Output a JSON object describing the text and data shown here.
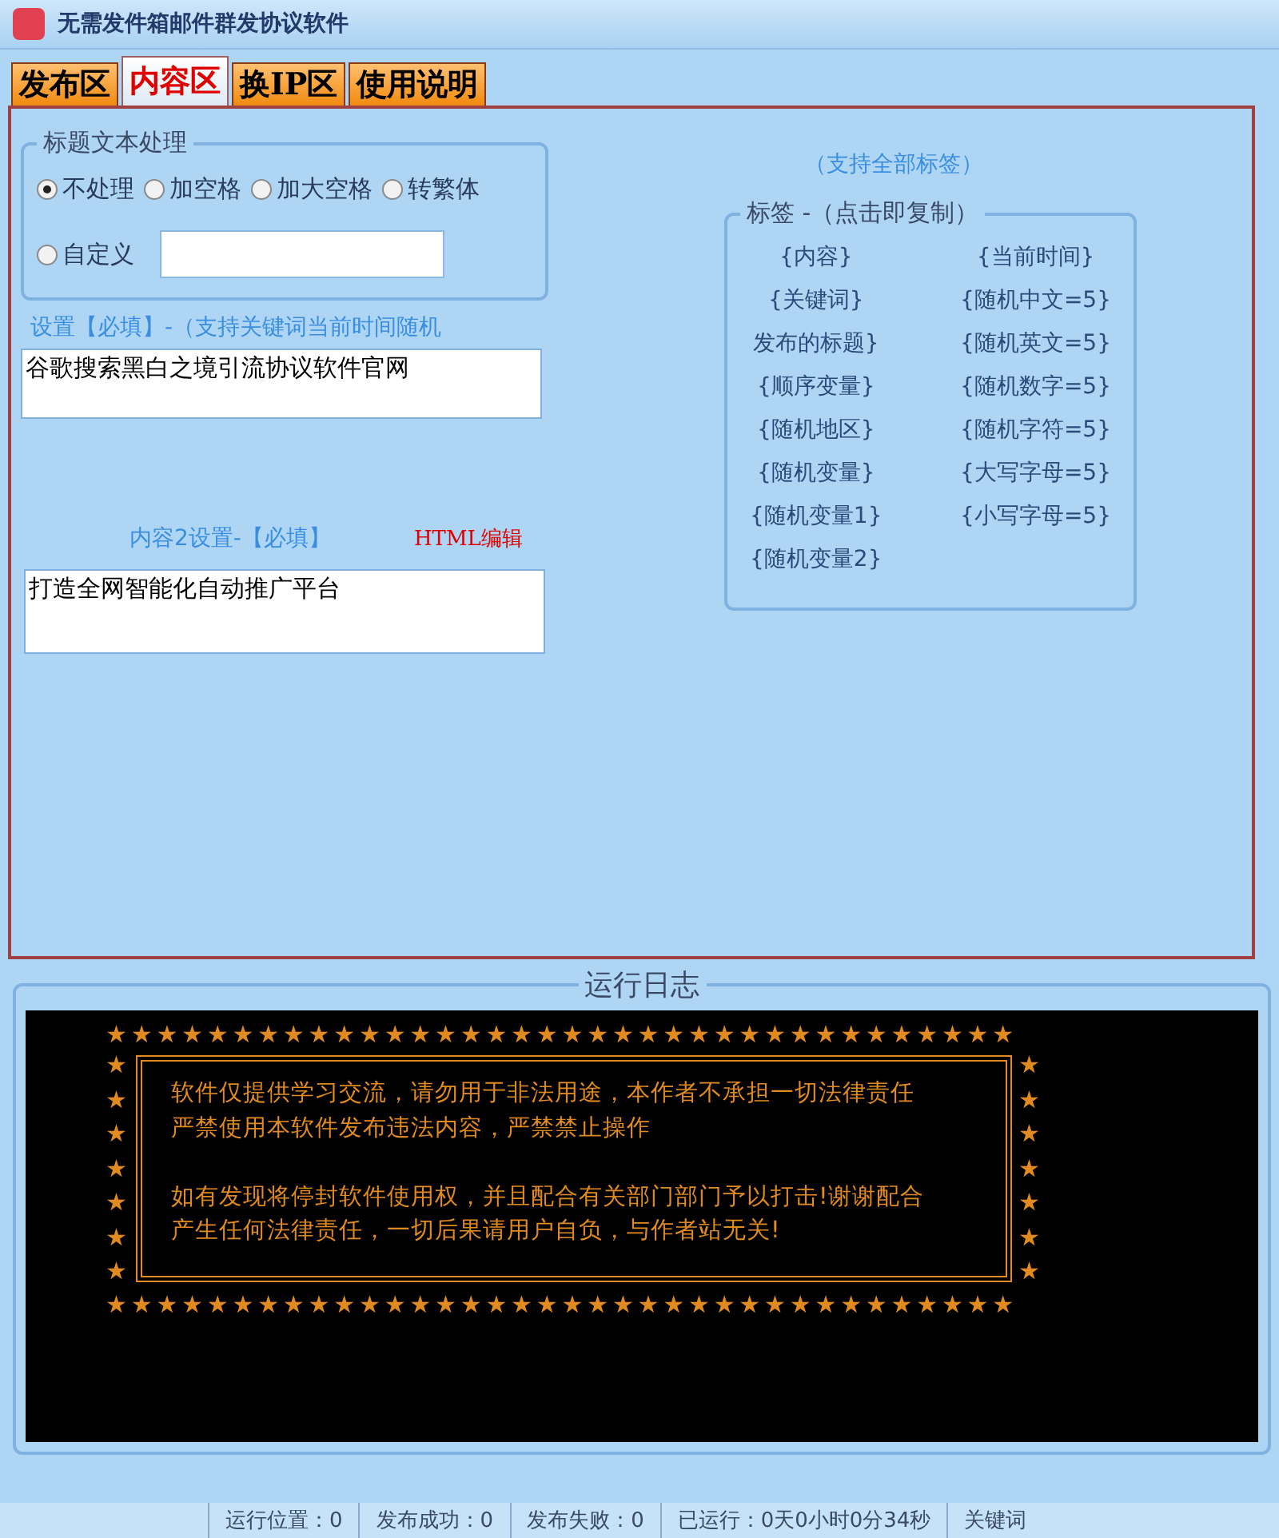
{
  "window": {
    "title": "无需发件箱邮件群发协议软件"
  },
  "tabs": [
    {
      "label": "发布区",
      "selected": false
    },
    {
      "label": "内容区",
      "selected": true
    },
    {
      "label": "换IP区",
      "selected": false
    },
    {
      "label": "使用说明",
      "selected": false
    }
  ],
  "title_processing": {
    "legend": "标题文本处理",
    "options": [
      {
        "label": "不处理",
        "selected": true
      },
      {
        "label": "加空格",
        "selected": false
      },
      {
        "label": "加大空格",
        "selected": false
      },
      {
        "label": "转繁体",
        "selected": false
      },
      {
        "label": "自定义",
        "selected": false
      }
    ]
  },
  "content1": {
    "label": "设置【必填】-（支持关键词当前时间随机",
    "value": "谷歌搜索黑白之境引流协议软件官网"
  },
  "content2": {
    "label": "内容2设置-【必填】",
    "html_link": "HTML编辑",
    "value": "打造全网智能化自动推广平台"
  },
  "tags": {
    "note": "（支持全部标签）",
    "legend": "标签 -（点击即复制）",
    "left": [
      "{内容}",
      "{关键词}",
      "发布的标题}",
      "{顺序变量}",
      "{随机地区}",
      "{随机变量}",
      "{随机变量1}",
      "{随机变量2}"
    ],
    "right": [
      "{当前时间}",
      "{随机中文=5}",
      "{随机英文=5}",
      "{随机数字=5}",
      "{随机字符=5}",
      "{大写字母=5}",
      "{小写字母=5}"
    ]
  },
  "log": {
    "legend": "运行日志",
    "top_stars": "★★★★★★★★★★★★★★★★★★★★★★★★★★★★★★★★★★★★",
    "left_stars": "★★★★★★★",
    "right_stars": "★★★★★★★",
    "bottom_stars": "★★★★★★★★★★★★★★★★★★★★★★★★★★★★★★★★★★★★",
    "paragraphs": [
      [
        "软件仅提供学习交流，请勿用于非法用途，本作者不承担一切法律责任",
        "严禁使用本软件发布违法内容，严禁禁止操作"
      ],
      [
        "如有发现将停封软件使用权，并且配合有关部门部门予以打击!谢谢配合",
        "产生任何法律责任，一切后果请用户自负，与作者站无关!"
      ]
    ]
  },
  "status_bar": [
    "运行位置：0",
    "发布成功：0",
    "发布失败：0",
    "已运行：0天0小时0分34秒",
    "关键词"
  ]
}
